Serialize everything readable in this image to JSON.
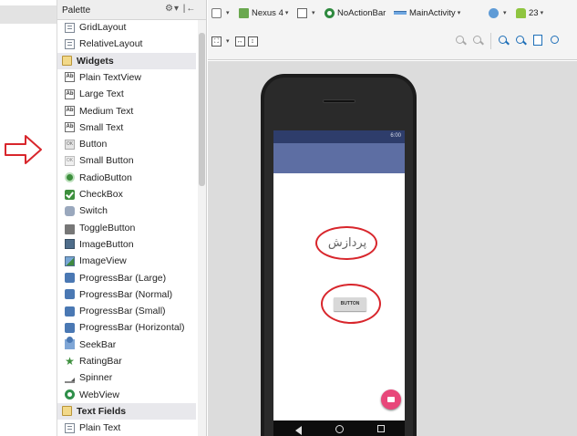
{
  "palette": {
    "title": "Palette",
    "items": [
      {
        "label": "GridLayout",
        "icon": "grid-layout-icon"
      },
      {
        "label": "RelativeLayout",
        "icon": "relative-layout-icon"
      },
      {
        "label": "Widgets",
        "icon": "folder-icon",
        "category": true
      },
      {
        "label": "Plain TextView",
        "icon": "textview-icon"
      },
      {
        "label": "Large Text",
        "icon": "large-text-icon"
      },
      {
        "label": "Medium Text",
        "icon": "medium-text-icon"
      },
      {
        "label": "Small Text",
        "icon": "small-text-icon"
      },
      {
        "label": "Button",
        "icon": "button-icon"
      },
      {
        "label": "Small Button",
        "icon": "small-button-icon"
      },
      {
        "label": "RadioButton",
        "icon": "radio-button-icon"
      },
      {
        "label": "CheckBox",
        "icon": "checkbox-icon"
      },
      {
        "label": "Switch",
        "icon": "switch-icon"
      },
      {
        "label": "ToggleButton",
        "icon": "toggle-button-icon"
      },
      {
        "label": "ImageButton",
        "icon": "image-button-icon"
      },
      {
        "label": "ImageView",
        "icon": "image-view-icon"
      },
      {
        "label": "ProgressBar (Large)",
        "icon": "progress-bar-icon"
      },
      {
        "label": "ProgressBar (Normal)",
        "icon": "progress-bar-icon"
      },
      {
        "label": "ProgressBar (Small)",
        "icon": "progress-bar-icon"
      },
      {
        "label": "ProgressBar (Horizontal)",
        "icon": "progress-bar-icon"
      },
      {
        "label": "SeekBar",
        "icon": "seekbar-icon"
      },
      {
        "label": "RatingBar",
        "icon": "star-icon"
      },
      {
        "label": "Spinner",
        "icon": "spinner-icon"
      },
      {
        "label": "WebView",
        "icon": "webview-icon"
      },
      {
        "label": "Text Fields",
        "icon": "folder-icon",
        "category": true
      },
      {
        "label": "Plain Text",
        "icon": "text-field-icon"
      }
    ]
  },
  "toolbar": {
    "device": "Nexus 4",
    "theme": "NoActionBar",
    "activity": "MainActivity",
    "api": "23"
  },
  "icons": {
    "button_mini": "OK",
    "textview_mini": "Ab"
  },
  "preview": {
    "status_time": "6:00",
    "text_view": "پردازش",
    "button_label": "BUTTON"
  },
  "colors": {
    "status_bar": "#2e3d6b",
    "app_bar": "#5d6ea3",
    "fab": "#e8477a",
    "highlight_ring": "#d8262c",
    "arrow": "#d8262c"
  }
}
